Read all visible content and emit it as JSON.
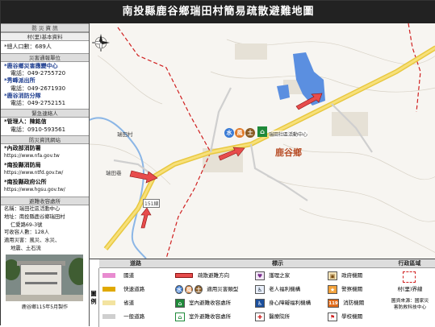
{
  "title": "南投縣鹿谷鄉瑞田村簡易疏散避難地圖",
  "panel": {
    "basic": {
      "head": "防 災 資 訊",
      "sub": "村(里)基本資料",
      "population": "*總人口數：689人"
    },
    "contacts": {
      "head": "災害通報單位",
      "items": [
        {
          "name": "*鹿谷鄉災害應變中心",
          "phone": "電話：049-2755720"
        },
        {
          "name": "*秀峰派出所",
          "phone": "電話：049-2671930"
        },
        {
          "name": "*鹿谷消防分隊",
          "phone": "電話：049-2752151"
        }
      ]
    },
    "emergency": {
      "head": "緊急連絡人",
      "name": "*管理人：陳銘信",
      "phone": "電話：0910-593561"
    },
    "websites": {
      "head": "防災資訊網站",
      "items": [
        {
          "name": "*內政部消防署",
          "url": "https://www.nfa.gov.tw"
        },
        {
          "name": "*南投縣消防局",
          "url": "https://www.ntfd.gov.tw/"
        },
        {
          "name": "*南投縣政府公所",
          "url": "https://www.hgsu.gov.tw/"
        }
      ]
    },
    "shelter": {
      "head": "避難收容處所",
      "name": "名稱：瑞田社區活動中心",
      "address": "地址：南投縣鹿谷鄉瑞田村",
      "address2": "仁愛路69-3號",
      "capacity": "可收容人數：128人",
      "disaster": "適用災害：風災、水災、",
      "disaster2": "地震、土石流"
    },
    "footer": "鹿谷鄉115年5月製作"
  },
  "map": {
    "labels": {
      "village": "瑞田村",
      "village2": "瑞田巷",
      "road": "151線",
      "center": "瑞田社區活動中心",
      "township": "鹿谷鄉"
    }
  },
  "legend": {
    "side": "圖 例",
    "headers": {
      "roads": "道路",
      "symbols": "標示",
      "admin": "行政區域"
    },
    "roads": [
      "國道",
      "快速道路",
      "省道",
      "一般道路"
    ],
    "col2": [
      "疏散避難方向",
      "適用災害類型",
      "室內避難收容處所",
      "室外避難收容處所"
    ],
    "col3": [
      "護理之家",
      "老人福利機構",
      "身心障礙福利機構",
      "醫療院所"
    ],
    "col4": [
      "政府機關",
      "警察機關",
      "消防機關",
      "學校機關"
    ],
    "admin_label": "村(里)界線",
    "source": "圖資來源：國家災害防救科技中心",
    "hazard_icons": {
      "water": "水",
      "wind": "風",
      "earth": "土"
    }
  }
}
